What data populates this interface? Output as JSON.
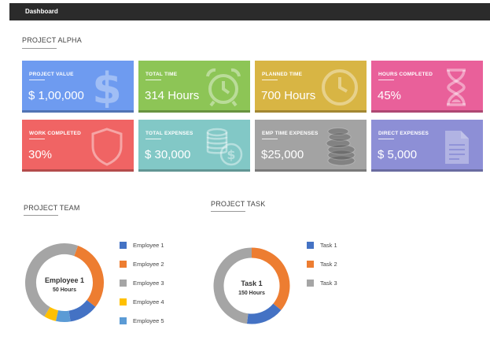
{
  "header": {
    "title": "Dashboard"
  },
  "project": {
    "title": "PROJECT ALPHA"
  },
  "cards": [
    {
      "label": "PROJECT VALUE",
      "value": "$ 1,00,000",
      "color": "#6e9bf0",
      "icon": "dollar-icon"
    },
    {
      "label": "TOTAL TIME",
      "value": "314 Hours",
      "color": "#8dc556",
      "icon": "alarm-clock-icon"
    },
    {
      "label": "PLANNED TIME",
      "value": "700 Hours",
      "color": "#d8b544",
      "icon": "clock-icon"
    },
    {
      "label": "HOURS COMPLETED",
      "value": "45%",
      "color": "#e9609a",
      "icon": "hourglass-icon"
    },
    {
      "label": "WORK COMPLETED",
      "value": "30%",
      "color": "#f06464",
      "icon": "shield-icon"
    },
    {
      "label": "TOTAL EXPENSES",
      "value": "$ 30,000",
      "color": "#82c8c6",
      "icon": "coins-dollar-icon"
    },
    {
      "label": "EMP TIME EXPENSES",
      "value": "$25,000",
      "color": "#a3a3a3",
      "icon": "coin-stack-icon"
    },
    {
      "label": "DIRECT EXPENSES",
      "value": "$ 5,000",
      "color": "#8d8fd6",
      "icon": "document-icon"
    }
  ],
  "team": {
    "title": "PROJECT TEAM",
    "center_name": "Employee 1",
    "center_sub": "50 Hours",
    "legend": [
      {
        "label": "Employee 1",
        "color": "#4472c4"
      },
      {
        "label": "Employee 2",
        "color": "#ed7d31"
      },
      {
        "label": "Employee 3",
        "color": "#a5a5a5"
      },
      {
        "label": "Employee 4",
        "color": "#ffc000"
      },
      {
        "label": "Employee 5",
        "color": "#5b9bd5"
      }
    ],
    "shares": [
      12,
      30,
      47,
      5,
      6
    ]
  },
  "task": {
    "title": "PROJECT TASK",
    "center_name": "Task 1",
    "center_sub": "150 Hours",
    "legend": [
      {
        "label": "Task 1",
        "color": "#4472c4"
      },
      {
        "label": "Task 2",
        "color": "#ed7d31"
      },
      {
        "label": "Task 3",
        "color": "#a5a5a5"
      }
    ],
    "shares": [
      16,
      36,
      48
    ]
  }
}
